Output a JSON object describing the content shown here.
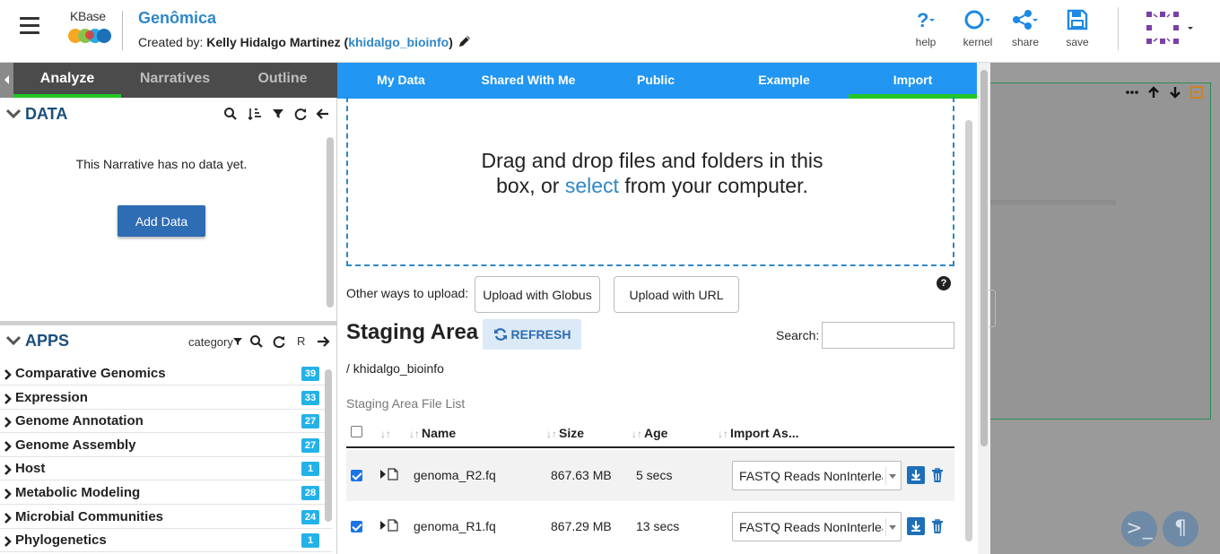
{
  "header": {
    "logo_text": "KBase",
    "narrative_title": "Genômica",
    "created_by_label": "Created by:",
    "author_name": "Kelly Hidalgo Martinez",
    "author_user": "khidalgo_bioinfo",
    "toolbar": [
      {
        "label": "help",
        "icon": "help-icon"
      },
      {
        "label": "kernel",
        "icon": "kernel-icon"
      },
      {
        "label": "share",
        "icon": "share-icon"
      },
      {
        "label": "save",
        "icon": "save-icon"
      }
    ]
  },
  "left_panel": {
    "tabs": [
      "Analyze",
      "Narratives",
      "Outline"
    ],
    "active_tab": "Analyze",
    "data": {
      "title": "DATA",
      "empty_message": "This Narrative has no data yet.",
      "add_button": "Add Data"
    },
    "apps": {
      "title": "APPS",
      "category_label": "category",
      "r_label": "R",
      "categories": [
        {
          "name": "Comparative Genomics",
          "count": "39"
        },
        {
          "name": "Expression",
          "count": "33"
        },
        {
          "name": "Genome Annotation",
          "count": "27"
        },
        {
          "name": "Genome Assembly",
          "count": "27"
        },
        {
          "name": "Host",
          "count": "1"
        },
        {
          "name": "Metabolic Modeling",
          "count": "28"
        },
        {
          "name": "Microbial Communities",
          "count": "24"
        },
        {
          "name": "Phylogenetics",
          "count": "1"
        }
      ]
    }
  },
  "data_browser": {
    "tabs": [
      "My Data",
      "Shared With Me",
      "Public",
      "Example",
      "Import"
    ],
    "active_tab": "Import",
    "dropzone": {
      "line1": "Drag and drop files and folders in this",
      "line2_before": "box, or ",
      "line2_link": "select",
      "line2_after": " from your computer."
    },
    "other_ways_label": "Other ways to upload:",
    "globus_button": "Upload with Globus",
    "url_button": "Upload with URL",
    "help_glyph": "?",
    "staging_title": "Staging Area",
    "refresh_button": "REFRESH",
    "search_label": "Search:",
    "path": "/ khidalgo_bioinfo",
    "file_list_label": "Staging Area File List",
    "columns": {
      "name": "Name",
      "size": "Size",
      "age": "Age",
      "import_as": "Import As..."
    },
    "files": [
      {
        "name": "genoma_R2.fq",
        "size": "867.63 MB",
        "age": "5 secs",
        "import_as": "FASTQ Reads NonInterleaved",
        "checked": true
      },
      {
        "name": "genoma_R1.fq",
        "size": "867.29 MB",
        "age": "13 secs",
        "import_as": "FASTQ Reads NonInterleaved",
        "checked": true
      }
    ]
  },
  "right_area": {
    "terminal_glyph": ">_",
    "pilcrow_glyph": "¶"
  },
  "colors": {
    "accent_blue": "#2196f3",
    "title_blue": "#2e87c8",
    "active_green": "#23c623",
    "badge_cyan": "#23b2e8",
    "dark_tabbar": "#4b4b4b"
  }
}
